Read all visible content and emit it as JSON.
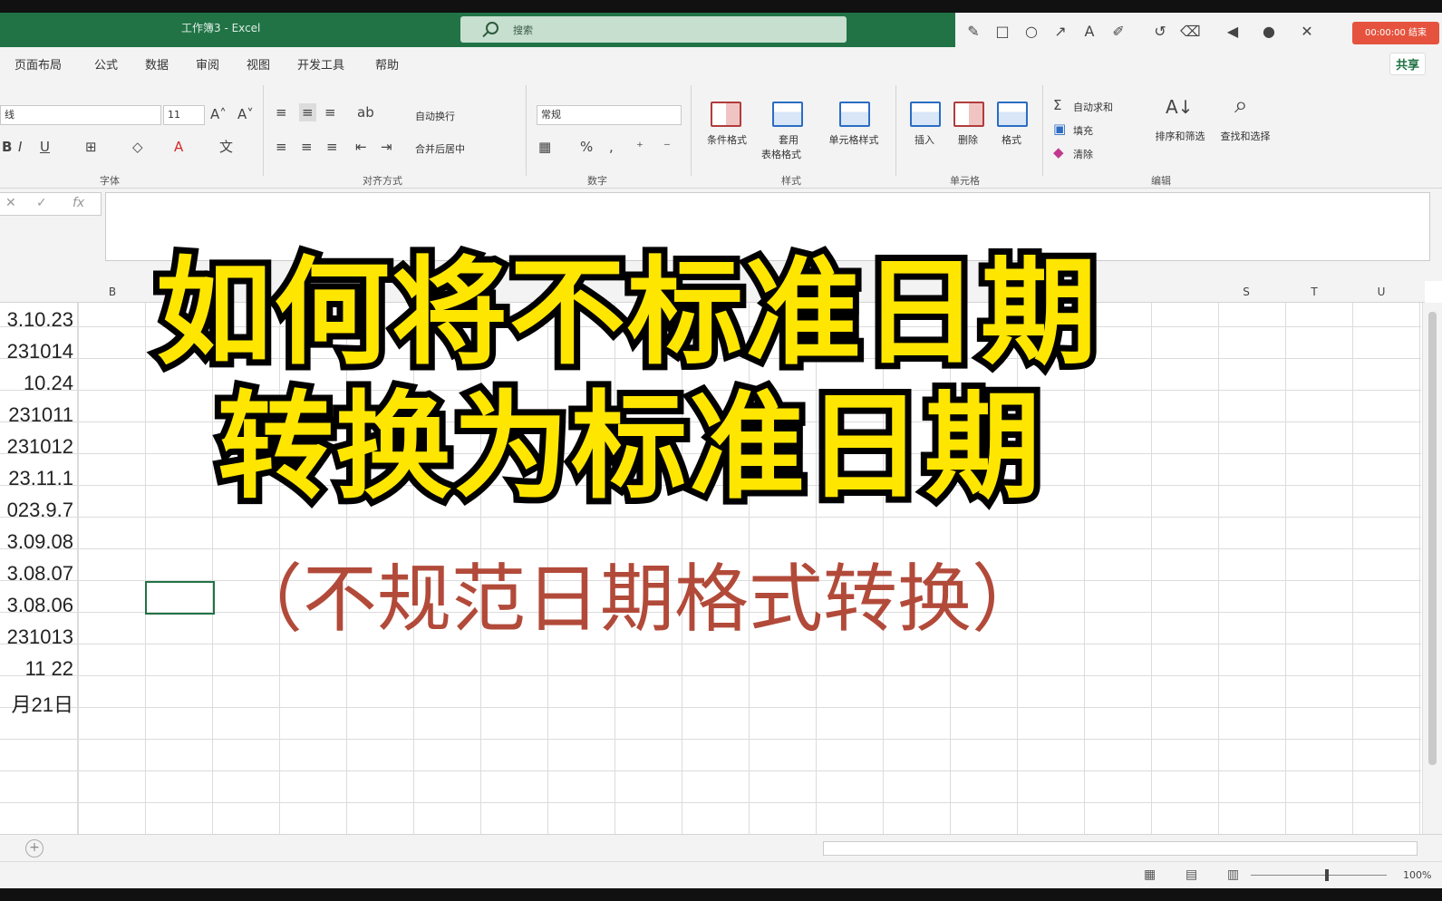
{
  "window": {
    "title": "工作簿3 - Excel",
    "search_placeholder": "搜索"
  },
  "recorder": {
    "timer_label": "00:00:00 结束",
    "accent": "#e5533e"
  },
  "menu": {
    "items": [
      "页面布局",
      "公式",
      "数据",
      "审阅",
      "视图",
      "开发工具",
      "帮助"
    ],
    "share_label": "共享"
  },
  "ribbon": {
    "font_name": "线",
    "font_size": "11",
    "groups": {
      "font": "字体",
      "alignment": "对齐方式",
      "number": "数字",
      "styles": "样式",
      "cells": "单元格",
      "editing": "编辑"
    },
    "wrap_text": "自动换行",
    "merge_center": "合并后居中",
    "number_format": "常规",
    "conditional_format": "条件格式",
    "table_format_line1": "套用",
    "table_format_line2": "表格格式",
    "cell_styles": "单元格样式",
    "insert": "插入",
    "delete": "删除",
    "format": "格式",
    "autosum": "自动求和",
    "fill": "填充",
    "clear": "清除",
    "sort_filter": "排序和筛选",
    "find_select": "查找和选择"
  },
  "formula_bar": {
    "cancel": "✕",
    "enter": "✓",
    "fx": "fx"
  },
  "columns": [
    "B",
    "S",
    "T",
    "U"
  ],
  "column_a_values": [
    "3.10.23",
    "231014",
    "10.24",
    "231011",
    "231012",
    "23.11.1",
    "023.9.7",
    "3.09.08",
    "3.08.07",
    "3.08.06",
    "231013",
    "11 22",
    "月21日"
  ],
  "caption": {
    "line1": "如何将不标准日期",
    "line2": "转换为标准日期",
    "subtitle": "（不规范日期格式转换）",
    "title_color": "#ffe600",
    "subtitle_color": "#b24a3a"
  },
  "status": {
    "zoom": "100%"
  }
}
